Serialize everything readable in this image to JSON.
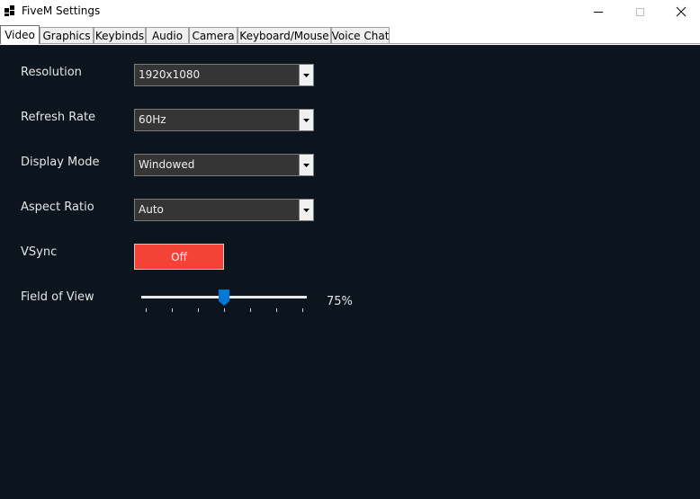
{
  "window": {
    "title": "FiveM Settings",
    "icon": "app-grid-icon",
    "controls": [
      "minimize-icon",
      "maximize-icon",
      "close-icon"
    ]
  },
  "tabs": [
    {
      "label": "Video",
      "active": true
    },
    {
      "label": "Graphics",
      "active": false
    },
    {
      "label": "Keybinds",
      "active": false
    },
    {
      "label": "Audio",
      "active": false
    },
    {
      "label": "Camera",
      "active": false
    },
    {
      "label": "Keyboard/Mouse",
      "active": false
    },
    {
      "label": "Voice Chat",
      "active": false
    }
  ],
  "video": {
    "resolution": {
      "label": "Resolution",
      "value": "1920x1080"
    },
    "refresh_rate": {
      "label": "Refresh Rate",
      "value": "60Hz"
    },
    "display_mode": {
      "label": "Display Mode",
      "value": "Windowed"
    },
    "aspect_ratio": {
      "label": "Aspect Ratio",
      "value": "Auto"
    },
    "vsync": {
      "label": "VSync",
      "value": "Off",
      "color": "#f44336"
    },
    "fov": {
      "label": "Field of View",
      "value_text": "75%",
      "fraction": 0.5,
      "tick_count": 6
    }
  },
  "colors": {
    "panel_bg": "#0c141e",
    "combo_bg": "#353535",
    "slider_thumb": "#0078d7",
    "toggle_off": "#f44336"
  }
}
